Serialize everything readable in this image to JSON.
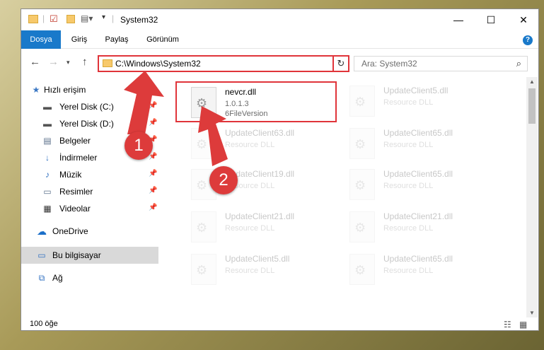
{
  "window": {
    "title": "System32",
    "minimize": "—",
    "maximize": "☐",
    "close": "✕"
  },
  "ribbon": {
    "tabs": [
      {
        "label": "Dosya",
        "active": true
      },
      {
        "label": "Giriş",
        "active": false
      },
      {
        "label": "Paylaş",
        "active": false
      },
      {
        "label": "Görünüm",
        "active": false
      }
    ],
    "help": "?"
  },
  "nav": {
    "address": "C:\\Windows\\System32",
    "search_placeholder": "Ara: System32"
  },
  "sidebar": {
    "items": [
      {
        "label": "Hızlı erişim",
        "icon": "★",
        "pinned": false
      },
      {
        "label": "Yerel Disk (C:)",
        "icon": "▬",
        "pinned": true
      },
      {
        "label": "Yerel Disk (D:)",
        "icon": "▬",
        "pinned": true
      },
      {
        "label": "Belgeler",
        "icon": "▤",
        "pinned": true
      },
      {
        "label": "İndirmeler",
        "icon": "↓",
        "pinned": true
      },
      {
        "label": "Müzik",
        "icon": "♪",
        "pinned": true
      },
      {
        "label": "Resimler",
        "icon": "▭",
        "pinned": true
      },
      {
        "label": "Videolar",
        "icon": "▦",
        "pinned": true
      },
      {
        "label": "OneDrive",
        "icon": "☁",
        "pinned": false
      },
      {
        "label": "Bu bilgisayar",
        "icon": "▭",
        "pinned": false
      },
      {
        "label": "Ağ",
        "icon": "⧉",
        "pinned": false
      }
    ]
  },
  "files": [
    {
      "name": "nevcr.dll",
      "line2": "1.0.1.3",
      "line3": "6FileVersion"
    },
    {
      "name": "UpdateClient5.dll",
      "line2": "Resource DLL",
      "line3": ""
    },
    {
      "name": "UpdateClient63.dll",
      "line2": "Resource DLL",
      "line3": ""
    },
    {
      "name": "UpdateClient65.dll",
      "line2": "Resource DLL",
      "line3": ""
    },
    {
      "name": "UpdateClient19.dll",
      "line2": "Resource DLL",
      "line3": ""
    },
    {
      "name": "UpdateClient65.dll",
      "line2": "Resource DLL",
      "line3": ""
    },
    {
      "name": "UpdateClient21.dll",
      "line2": "Resource DLL",
      "line3": ""
    },
    {
      "name": "UpdateClient21.dll",
      "line2": "Resource DLL",
      "line3": ""
    },
    {
      "name": "UpdateClient5.dll",
      "line2": "Resource DLL",
      "line3": ""
    },
    {
      "name": "UpdateClient65.dll",
      "line2": "Resource DLL",
      "line3": ""
    }
  ],
  "status": {
    "count": "100 öğe"
  },
  "annotations": {
    "step1": "1",
    "step2": "2",
    "color": "#dd3b3b"
  }
}
